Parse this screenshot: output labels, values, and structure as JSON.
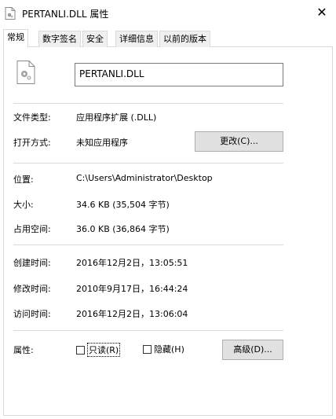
{
  "window": {
    "title": "PERTANLI.DLL 属性",
    "close_glyph": "✕"
  },
  "tabs": [
    "常规",
    "数字签名",
    "安全",
    "详细信息",
    "以前的版本"
  ],
  "general": {
    "filename": "PERTANLI.DLL",
    "rows": {
      "type_label": "文件类型:",
      "type_value": "应用程序扩展 (.DLL)",
      "open_label": "打开方式:",
      "open_value": "未知应用程序",
      "change_button": "更改(C)...",
      "location_label": "位置:",
      "location_value": "C:\\Users\\Administrator\\Desktop",
      "size_label": "大小:",
      "size_value": "34.6 KB (35,504 字节)",
      "disk_label": "占用空间:",
      "disk_value": "36.0 KB (36,864 字节)",
      "created_label": "创建时间:",
      "created_value": "2016年12月2日，13:05:51",
      "modified_label": "修改时间:",
      "modified_value": "2010年9月17日，16:44:24",
      "accessed_label": "访问时间:",
      "accessed_value": "2016年12月2日，13:06:04",
      "attr_label": "属性:",
      "readonly_label": "只读(R)",
      "hidden_label": "隐藏(H)",
      "advanced_button": "高级(D)..."
    }
  },
  "icons": {
    "title": "dll-file-icon",
    "file": "dll-file-icon"
  }
}
